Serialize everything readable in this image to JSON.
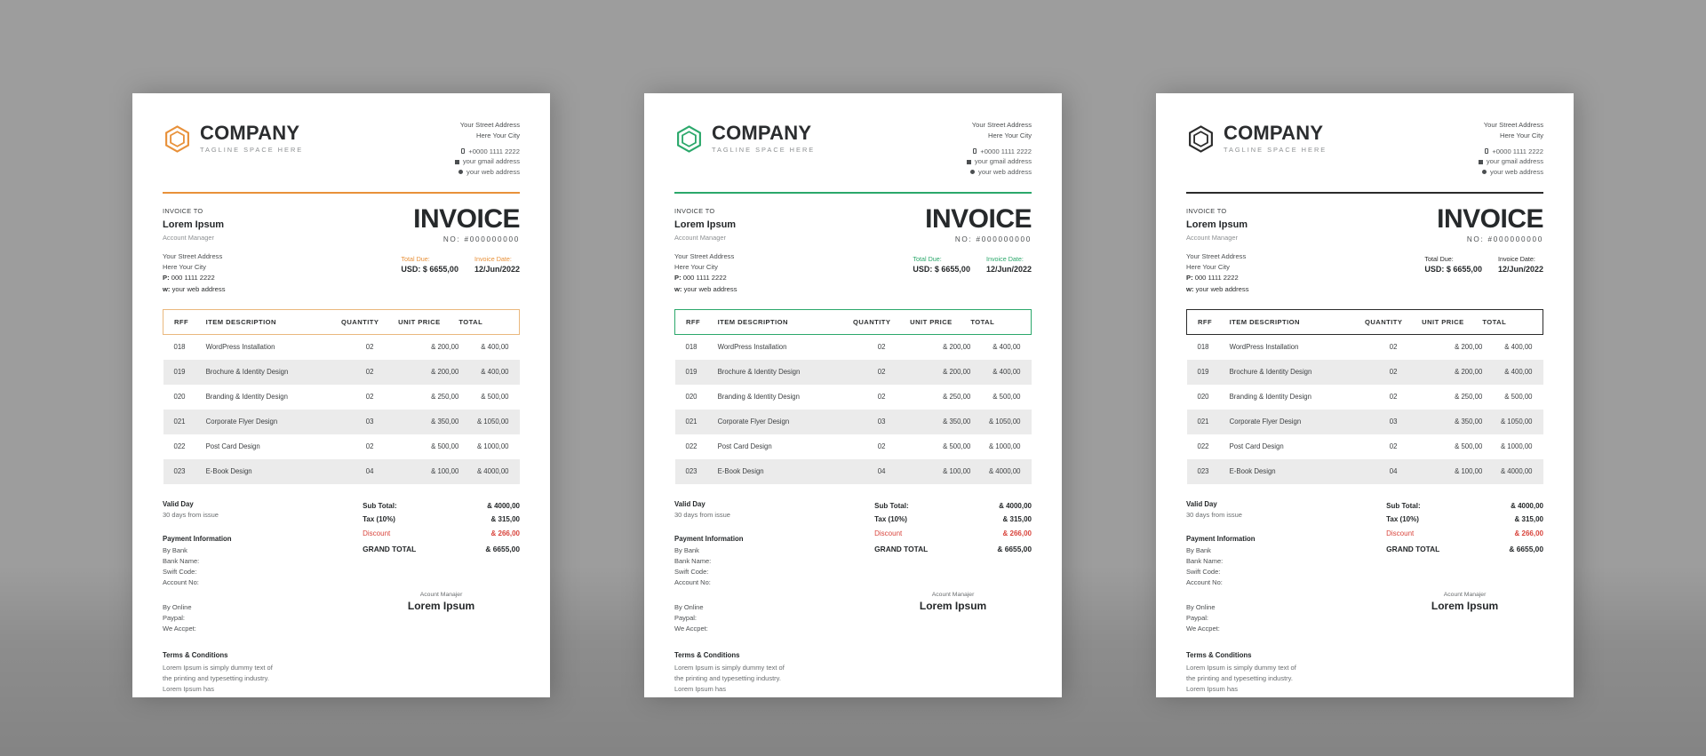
{
  "background_color": "#9d9d9d",
  "variants": [
    {
      "id": "orange",
      "accent": "#E8913A",
      "logo_color": "#E8913A"
    },
    {
      "id": "green",
      "accent": "#2BA86B",
      "logo_color": "#2BA86B"
    },
    {
      "id": "dark",
      "accent": "#2B2B2B",
      "logo_color": "#2B2B2B"
    }
  ],
  "brand": {
    "name": "COMPANY",
    "tagline": "TAGLINE SPACE HERE",
    "logo_icon": "hexagon-outline-icon"
  },
  "contact": {
    "address_line1": "Your Street Address",
    "address_line2": "Here Your City",
    "phone": "+0000 1111 2222",
    "email": "your gmail address",
    "website": "your web address",
    "phone_icon": "phone-icon",
    "email_icon": "mail-icon",
    "web_icon": "globe-icon"
  },
  "bill_to": {
    "label": "INVOICE TO",
    "client_name": "Lorem Ipsum",
    "client_role": "Account Manager",
    "address_line1": "Your Street Address",
    "address_line2": "Here Your City",
    "phone_label": "P:",
    "phone_value": "000 1111 2222",
    "web_label": "w:",
    "web_value": "your web address"
  },
  "title": {
    "heading": "INVOICE",
    "number_label": "NO:",
    "number_value": "#000000000",
    "total_due_label": "Total Due:",
    "total_due_value": "USD: $ 6655,00",
    "invoice_date_label": "Invoice Date:",
    "invoice_date_value": "12/Jun/2022"
  },
  "table": {
    "headers": [
      "RFF",
      "ITEM DESCRIPTION",
      "QUANTITY",
      "UNIT PRICE",
      "TOTAL"
    ],
    "rows": [
      {
        "ref": "018",
        "description": "WordPress Installation",
        "quantity": "02",
        "unit_price": "& 200,00",
        "total": "& 400,00"
      },
      {
        "ref": "019",
        "description": "Brochure & Identity Design",
        "quantity": "02",
        "unit_price": "& 200,00",
        "total": "& 400,00"
      },
      {
        "ref": "020",
        "description": "Branding & Identity Design",
        "quantity": "02",
        "unit_price": "& 250,00",
        "total": "& 500,00"
      },
      {
        "ref": "021",
        "description": "Corporate Flyer Design",
        "quantity": "03",
        "unit_price": "& 350,00",
        "total": "& 1050,00"
      },
      {
        "ref": "022",
        "description": "Post Card Design",
        "quantity": "02",
        "unit_price": "& 500,00",
        "total": "& 1000,00"
      },
      {
        "ref": "023",
        "description": "E-Book Design",
        "quantity": "04",
        "unit_price": "& 100,00",
        "total": "& 4000,00"
      }
    ]
  },
  "validity": {
    "heading": "Valid Day",
    "text": "30 days from issue"
  },
  "payment": {
    "heading": "Payment Information",
    "bank_heading": "By Bank",
    "bank_name_label": "Bank Name:",
    "swift_label": "Swift Code:",
    "account_label": "Account No:",
    "online_heading": "By Online",
    "paypal_label": "Paypal:",
    "accept_label": "We Accpet:"
  },
  "summary": {
    "subtotal_label": "Sub Total:",
    "subtotal_value": "& 4000,00",
    "tax_label": "Tax (10%)",
    "tax_value": "& 315,00",
    "discount_label": "Discount",
    "discount_value": "& 266,00",
    "discount_color": "#d9453d",
    "grand_total_label": "GRAND TOTAL",
    "grand_total_value": "& 6655,00"
  },
  "signature": {
    "caption": "Acount Manajer",
    "name": "Lorem Ipsum"
  },
  "terms": {
    "heading": "Terms & Conditions",
    "line1": "Lorem Ipsum is simply dummy text of",
    "line2": "the printing and typesetting industry.",
    "line3": "Lorem Ipsum has"
  }
}
